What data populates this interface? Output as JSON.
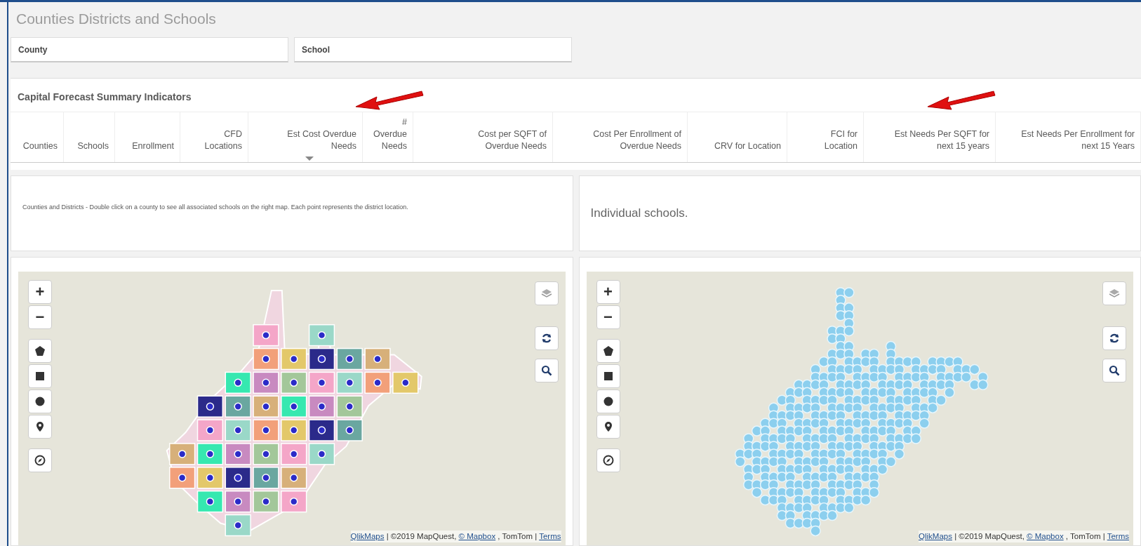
{
  "title": "Counties Districts and Schools",
  "filters": [
    {
      "label": "County"
    },
    {
      "label": "School"
    }
  ],
  "summary": {
    "title": "Capital Forecast Summary Indicators",
    "columns": [
      {
        "label": "Counties",
        "sorted": false
      },
      {
        "label": "Schools",
        "sorted": false
      },
      {
        "label": "Enrollment",
        "sorted": false
      },
      {
        "label": "CFD Locations",
        "sorted": false
      },
      {
        "label": "Est Cost Overdue Needs",
        "sorted": true
      },
      {
        "label": "# Overdue Needs",
        "sorted": false
      },
      {
        "label": "Cost per SQFT of Overdue Needs",
        "sorted": false
      },
      {
        "label": "Cost Per Enrollment of Overdue Needs",
        "sorted": false
      },
      {
        "label": "CRV for Location",
        "sorted": false
      },
      {
        "label": "FCI for Location",
        "sorted": false
      },
      {
        "label": "Est Needs Per SQFT for next 15 years",
        "sorted": false
      },
      {
        "label": "Est Needs Per Enrollment for next 15 Years",
        "sorted": false
      }
    ]
  },
  "panels": [
    {
      "kind": "note",
      "text": "Counties and Districts - Double click on a county to see all associated schools on the right map. Each point represents the district location."
    },
    {
      "kind": "heading",
      "text": "Individual schools."
    }
  ],
  "maps": [
    {
      "kind": "districts",
      "zoom_in": "+",
      "zoom_out": "−",
      "attribution": [
        {
          "text": "QlikMaps",
          "link": true
        },
        {
          "text": "| ©2019 MapQuest,",
          "link": false
        },
        {
          "text": "© Mapbox",
          "link": true
        },
        {
          "text": ", TomTom |",
          "link": false
        },
        {
          "text": "Terms",
          "link": true
        }
      ]
    },
    {
      "kind": "schools",
      "zoom_in": "+",
      "zoom_out": "−",
      "attribution": [
        {
          "text": "QlikMaps",
          "link": true
        },
        {
          "text": "| ©2019 MapQuest,",
          "link": false
        },
        {
          "text": "© Mapbox",
          "link": true
        },
        {
          "text": ", TomTom |",
          "link": false
        },
        {
          "text": "Terms",
          "link": true
        }
      ]
    }
  ]
}
